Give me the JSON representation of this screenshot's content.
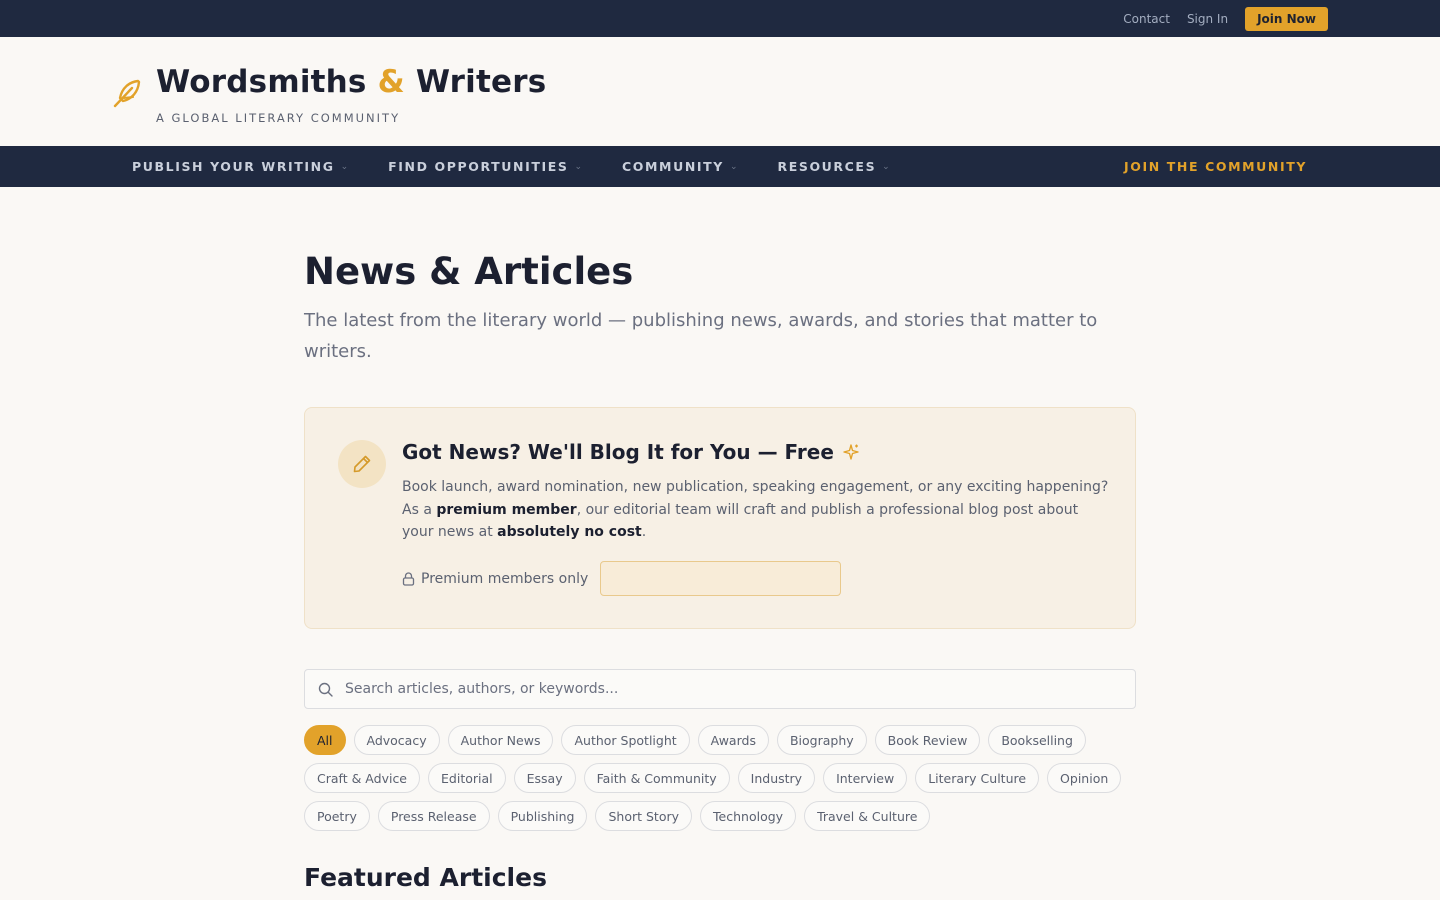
{
  "topbar": {
    "contact": "Contact",
    "sign_in": "Sign In",
    "join_now": "Join Now"
  },
  "brand": {
    "title_part1": "Wordsmiths",
    "title_amp": "&",
    "title_part2": "Writers",
    "tagline": "A GLOBAL LITERARY COMMUNITY",
    "logo_icon": "feather-icon",
    "accent_color": "#e2a22a",
    "nav_bg": "#1f2940"
  },
  "nav": {
    "items": [
      {
        "label": "PUBLISH YOUR WRITING"
      },
      {
        "label": "FIND OPPORTUNITIES"
      },
      {
        "label": "COMMUNITY"
      },
      {
        "label": "RESOURCES"
      }
    ],
    "join_community": "JOIN THE COMMUNITY"
  },
  "page": {
    "title": "News & Articles",
    "subtitle": "The latest from the literary world — publishing news, awards, and stories that matter to writers."
  },
  "promo": {
    "icon": "pencil-icon",
    "title": "Got News? We'll Blog It for You — Free",
    "title_icon": "sparkle-icon",
    "body_1": "Book launch, award nomination, new publication, speaking engagement, or any exciting happening? As a ",
    "body_bold_1": "premium member",
    "body_2": ", our editorial team will craft and publish a professional blog post about your news at ",
    "body_bold_2": "absolutely no cost",
    "body_3": ".",
    "premium_note": "Premium members only",
    "premium_icon": "lock-icon"
  },
  "search": {
    "placeholder": "Search articles, authors, or keywords...",
    "value": ""
  },
  "tags": {
    "rows": [
      [
        "All",
        "Advocacy",
        "Author News",
        "Author Spotlight",
        "Awards",
        "Biography",
        "Book Review",
        "Bookselling"
      ],
      [
        "Craft & Advice",
        "Editorial",
        "Essay",
        "Faith & Community",
        "Industry",
        "Interview",
        "Literary Culture",
        "Opinion"
      ],
      [
        "Poetry",
        "Press Release",
        "Publishing",
        "Short Story",
        "Technology",
        "Travel & Culture"
      ]
    ],
    "selected": "All"
  },
  "featured_heading": "Featured Articles"
}
